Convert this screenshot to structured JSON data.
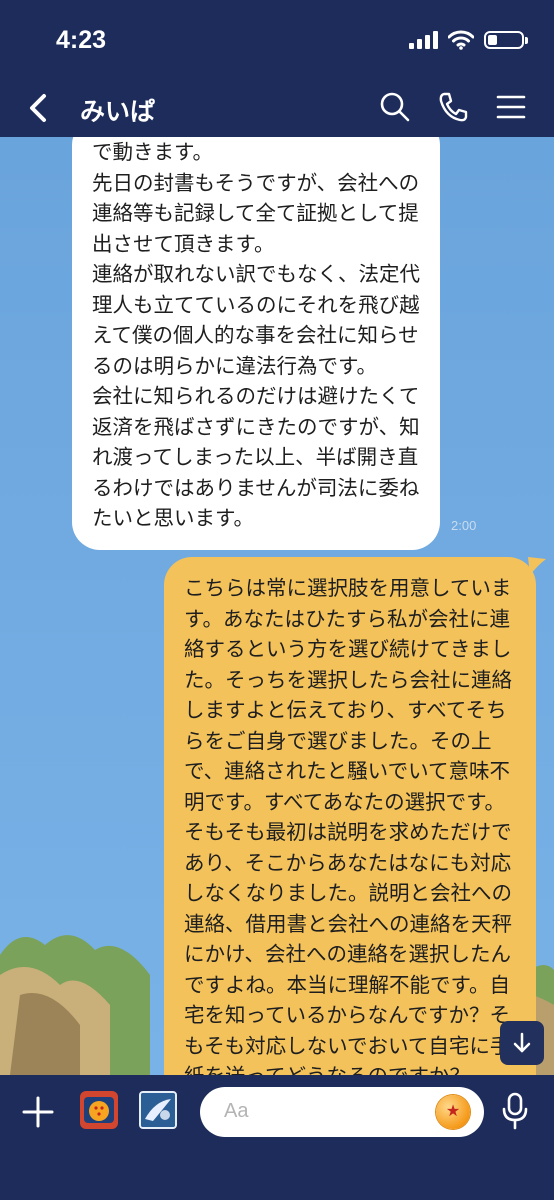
{
  "status_bar": {
    "time": "4:23"
  },
  "header": {
    "title": "みいぱ"
  },
  "messages": {
    "incoming": {
      "text": "で動きます。\n先日の封書もそうですが、会社への連絡等も記録して全て証拠として提出させて頂きます。\n連絡が取れない訳でもなく、法定代理人も立てているのにそれを飛び越えて僕の個人的な事を会社に知らせるのは明らかに違法行為です。\n会社に知られるのだけは避けたくて返済を飛ばさずにきたのですが、知れ渡ってしまった以上、半ば開き直るわけではありませんが司法に委ねたいと思います。",
      "time": "2:00"
    },
    "outgoing": {
      "text": "こちらは常に選択肢を用意しています。あなたはひたすら私が会社に連絡するという方を選び続けてきました。そっちを選択したら会社に連絡しますよと伝えており、すべてそちらをご自身で選びました。その上で、連絡されたと騒いでいて意味不明です。すべてあなたの選択です。そもそも最初は説明を求めただけであり、そこからあなたはなにも対応しなくなりました。説明と会社への連絡、借用書と会社への連絡を天秤にかけ、会社への連絡を選択したんですよね。本当に理解不能です。自宅を知っているからなんですか？そもそも対応しないでおいて自宅に手紙を送ってどうなるのですか？"
    }
  },
  "input": {
    "placeholder": "Aa"
  },
  "colors": {
    "header_bg": "#1d2c5a",
    "outgoing_bubble": "#f3c25b",
    "incoming_bubble": "#ffffff",
    "chat_bg": "#6ea8dd"
  },
  "icons": [
    "back-icon",
    "search-icon",
    "phone-icon",
    "menu-icon",
    "plus-icon",
    "mic-icon",
    "arrow-down-icon",
    "wifi-icon",
    "signal-icon",
    "battery-icon"
  ]
}
